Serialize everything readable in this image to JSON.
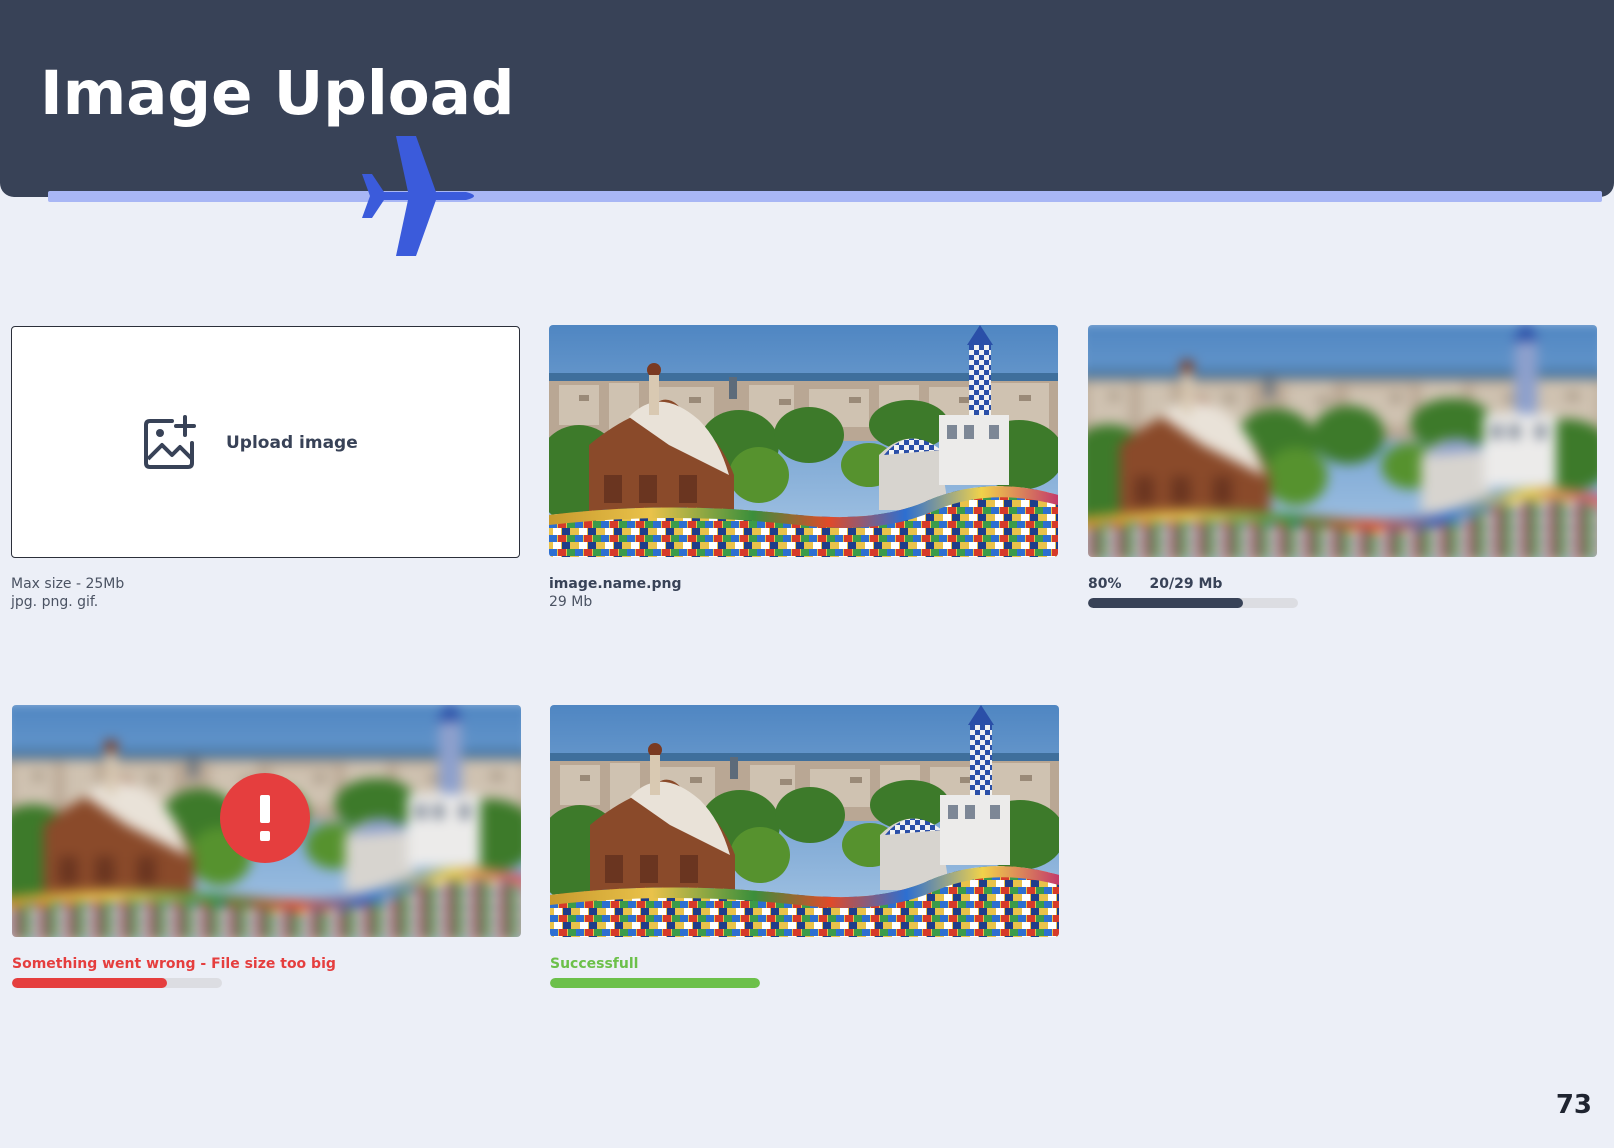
{
  "header": {
    "title": "Image Upload"
  },
  "colors": {
    "header_bg": "#384257",
    "accent_line": "#a8b6f5",
    "plane": "#3b5bdb",
    "error": "#e53e3e",
    "success": "#6cc04a",
    "progress": "#384257"
  },
  "upload": {
    "label": "Upload image",
    "icon": "image-add-icon",
    "max_size": "Max size - 25Mb",
    "formats": "jpg. png. gif."
  },
  "selected": {
    "file_name": "image.name.png",
    "file_size": "29 Mb"
  },
  "uploading": {
    "percent_label": "80%",
    "size_label": "20/29 Mb",
    "progress_fraction": 0.74
  },
  "error": {
    "message": "Something went wrong - File size too big",
    "icon": "exclamation-icon",
    "progress_fraction": 0.74
  },
  "success": {
    "message": "Successfull",
    "progress_fraction": 1.0
  },
  "page_number": "73"
}
